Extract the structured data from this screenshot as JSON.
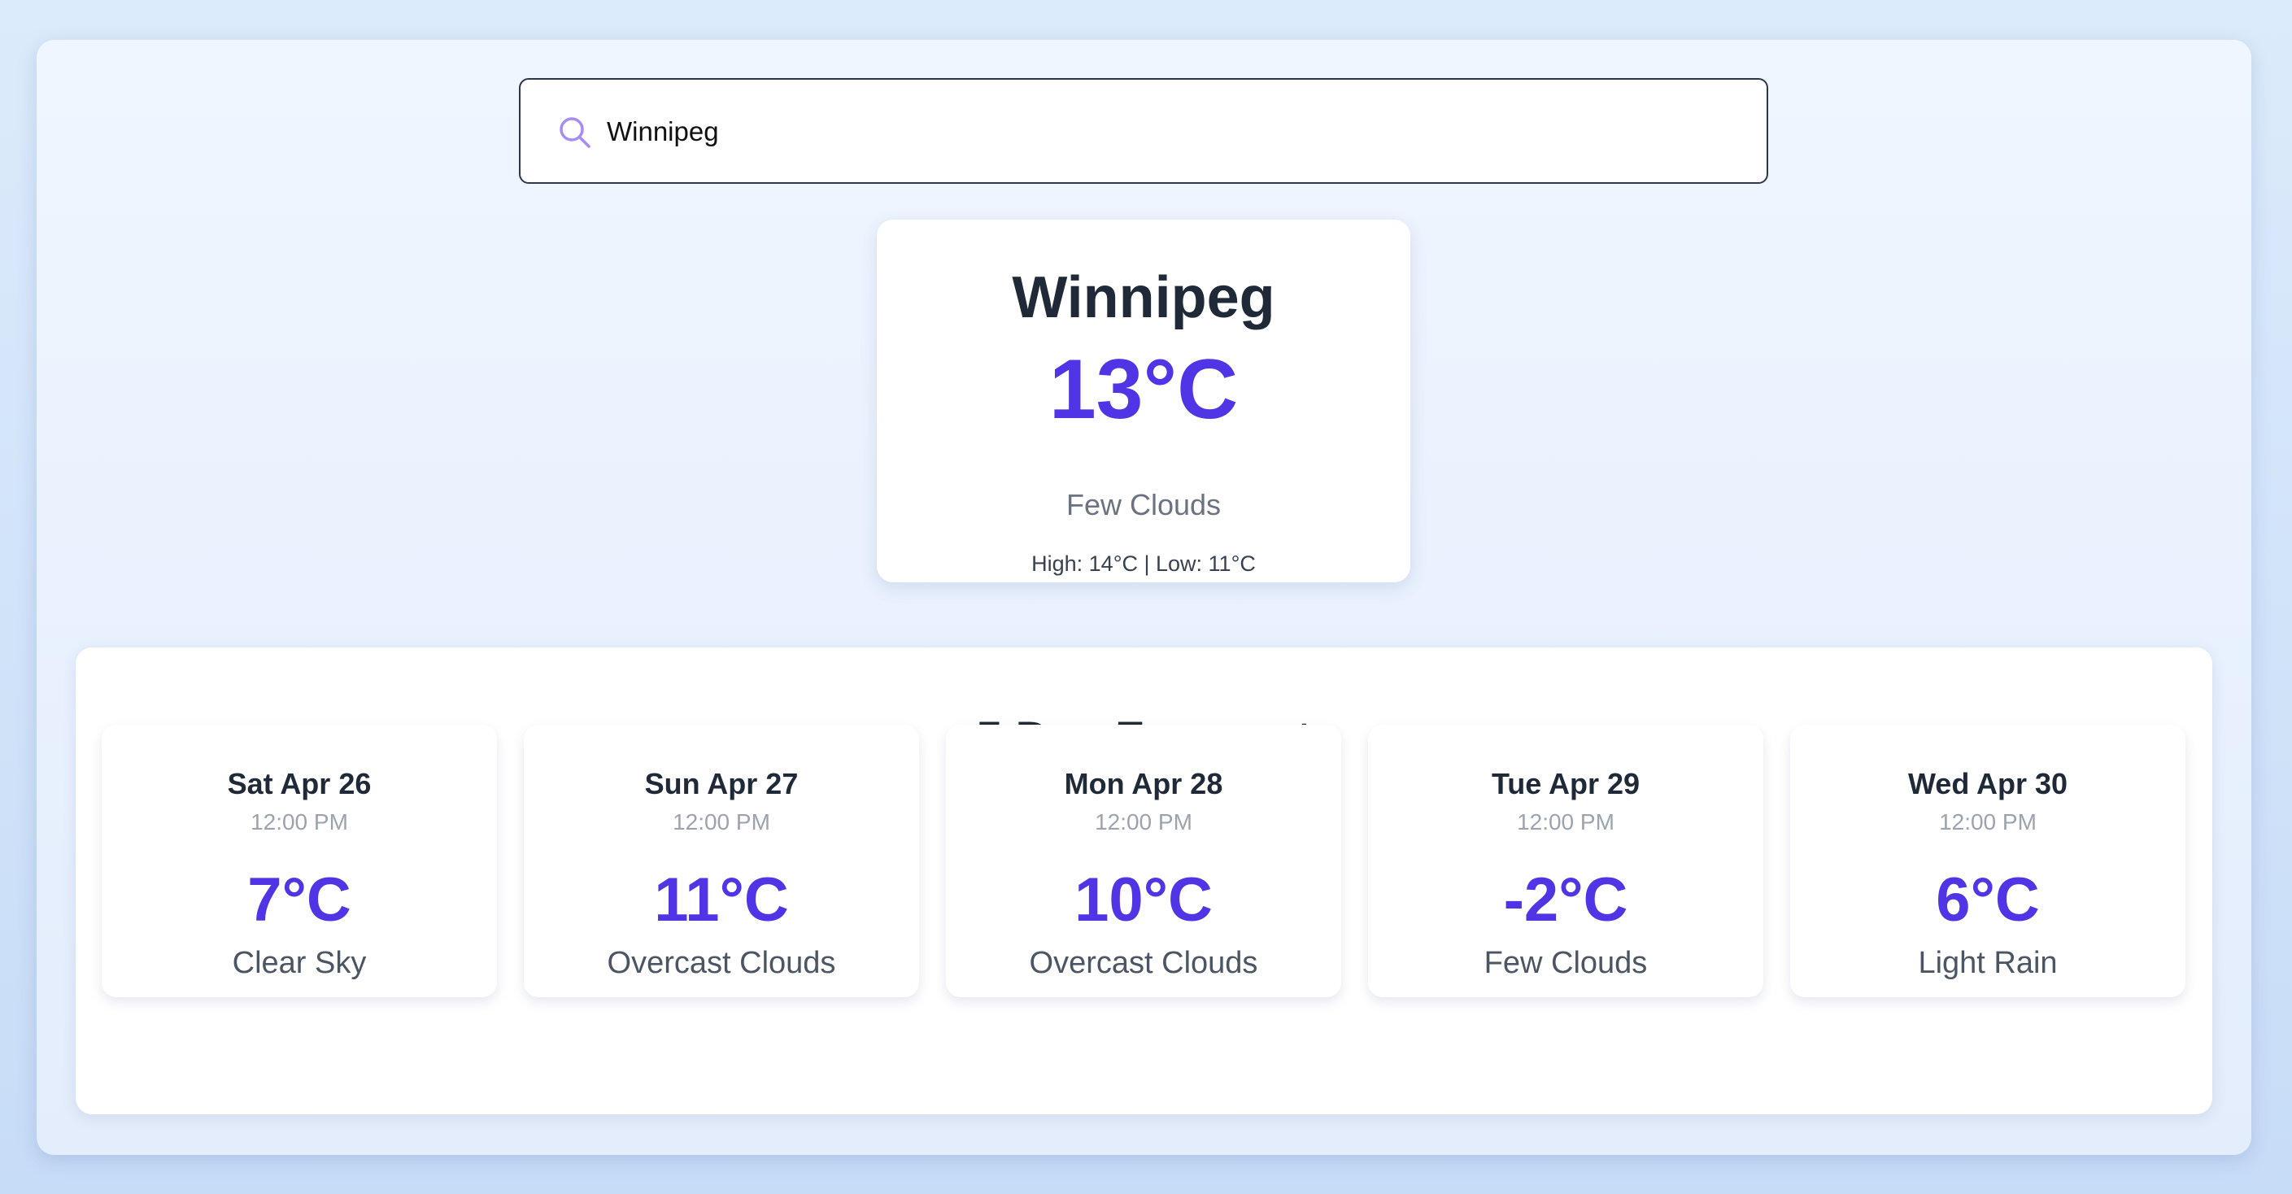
{
  "search": {
    "icon": "search-icon",
    "value": "Winnipeg",
    "placeholder": ""
  },
  "current": {
    "city": "Winnipeg",
    "temperature": "13°C",
    "description": "Few Clouds",
    "high_low": "High: 14°C | Low: 11°C"
  },
  "forecast": {
    "title": "5 Day Forecast",
    "days": [
      {
        "date": "Sat Apr 26",
        "time": "12:00 PM",
        "temperature": "7°C",
        "description": "Clear Sky"
      },
      {
        "date": "Sun Apr 27",
        "time": "12:00 PM",
        "temperature": "11°C",
        "description": "Overcast Clouds"
      },
      {
        "date": "Mon Apr 28",
        "time": "12:00 PM",
        "temperature": "10°C",
        "description": "Overcast Clouds"
      },
      {
        "date": "Tue Apr 29",
        "time": "12:00 PM",
        "temperature": "-2°C",
        "description": "Few Clouds"
      },
      {
        "date": "Wed Apr 30",
        "time": "12:00 PM",
        "temperature": "6°C",
        "description": "Light Rain"
      }
    ]
  },
  "colors": {
    "accent": "#4f35e6",
    "search_icon": "#a78bfa",
    "heading": "#1f2937",
    "muted": "#6b7280"
  }
}
